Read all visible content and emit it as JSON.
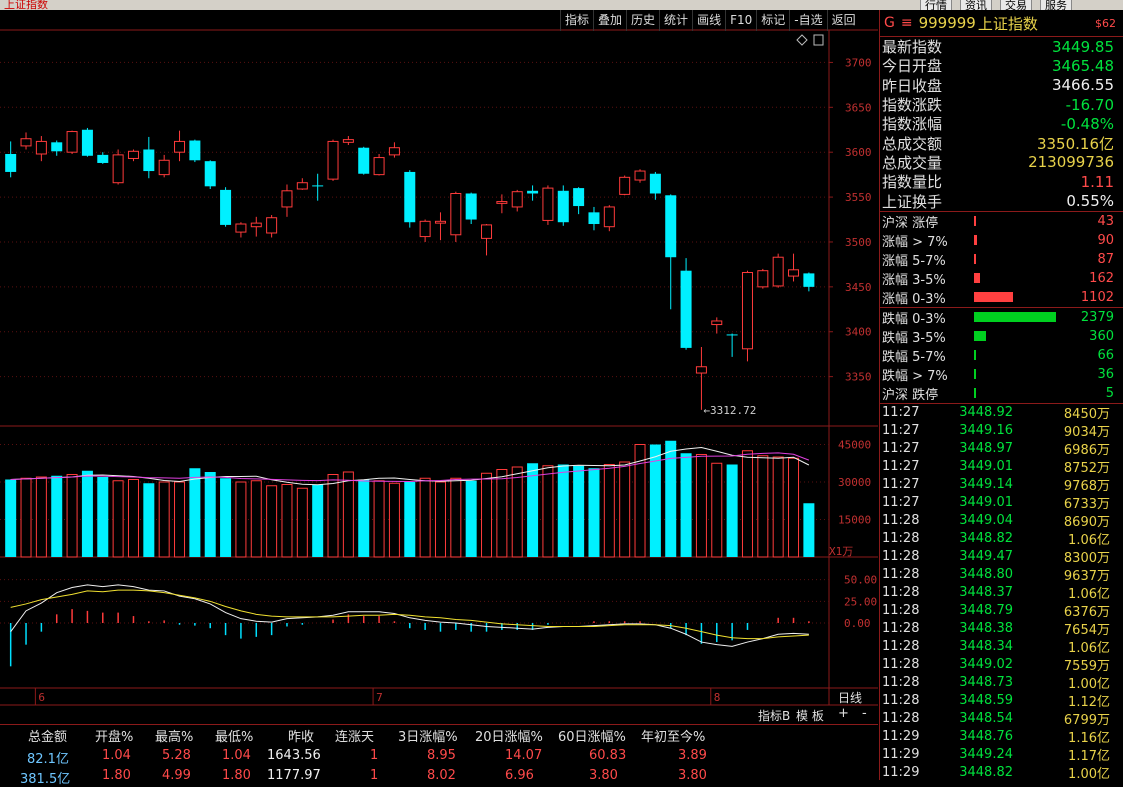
{
  "window": {
    "title_fragment": "上证指数"
  },
  "toolbar": {
    "items": [
      "指标",
      "叠加",
      "历史",
      "统计",
      "画线",
      "F10",
      "标记",
      "-自选",
      "返回"
    ]
  },
  "quote": {
    "code": "999999",
    "name": "上证指数",
    "g_label": "G",
    "menu_glyph": "≡",
    "badge": "$62",
    "fields": [
      {
        "label": "最新指数",
        "value": "3449.85",
        "color": "green"
      },
      {
        "label": "今日开盘",
        "value": "3465.48",
        "color": "green"
      },
      {
        "label": "昨日收盘",
        "value": "3466.55",
        "color": "white"
      },
      {
        "label": "指数涨跌",
        "value": "-16.70",
        "color": "green"
      },
      {
        "label": "指数涨幅",
        "value": "-0.48%",
        "color": "green"
      },
      {
        "label": "总成交额",
        "value": "3350.16亿",
        "color": "yellow"
      },
      {
        "label": "总成交量",
        "value": "213099736",
        "color": "yellow"
      },
      {
        "label": "指数量比",
        "value": "1.11",
        "color": "red"
      },
      {
        "label": "上证换手",
        "value": "0.55%",
        "color": "white"
      }
    ]
  },
  "breadth": {
    "up": [
      {
        "label": "沪深 涨停",
        "value": "43",
        "fraction": 0.0
      },
      {
        "label": "涨幅 > 7%",
        "value": "90",
        "fraction": 0.04
      },
      {
        "label": "涨幅 5-7%",
        "value": "87",
        "fraction": 0.03
      },
      {
        "label": "涨幅 3-5%",
        "value": "162",
        "fraction": 0.07
      },
      {
        "label": "涨幅 0-3%",
        "value": "1102",
        "fraction": 0.47
      }
    ],
    "down": [
      {
        "label": "跌幅 0-3%",
        "value": "2379",
        "fraction": 1.0
      },
      {
        "label": "跌幅 3-5%",
        "value": "360",
        "fraction": 0.15
      },
      {
        "label": "跌幅 5-7%",
        "value": "66",
        "fraction": 0.03
      },
      {
        "label": "跌幅 > 7%",
        "value": "36",
        "fraction": 0.01
      },
      {
        "label": "沪深 跌停",
        "value": "5",
        "fraction": 0.0
      }
    ]
  },
  "ticks": [
    {
      "time": "11:27",
      "price": "3448.92",
      "vol": "8450万"
    },
    {
      "time": "11:27",
      "price": "3449.16",
      "vol": "9034万"
    },
    {
      "time": "11:27",
      "price": "3448.97",
      "vol": "6986万"
    },
    {
      "time": "11:27",
      "price": "3449.01",
      "vol": "8752万"
    },
    {
      "time": "11:27",
      "price": "3449.14",
      "vol": "9768万"
    },
    {
      "time": "11:27",
      "price": "3449.01",
      "vol": "6733万"
    },
    {
      "time": "11:28",
      "price": "3449.04",
      "vol": "8690万"
    },
    {
      "time": "11:28",
      "price": "3448.82",
      "vol": "1.06亿"
    },
    {
      "time": "11:28",
      "price": "3449.47",
      "vol": "8300万"
    },
    {
      "time": "11:28",
      "price": "3448.80",
      "vol": "9637万"
    },
    {
      "time": "11:28",
      "price": "3448.37",
      "vol": "1.06亿"
    },
    {
      "time": "11:28",
      "price": "3448.79",
      "vol": "6376万"
    },
    {
      "time": "11:28",
      "price": "3448.38",
      "vol": "7654万"
    },
    {
      "time": "11:28",
      "price": "3448.34",
      "vol": "1.06亿"
    },
    {
      "time": "11:28",
      "price": "3449.02",
      "vol": "7559万"
    },
    {
      "time": "11:28",
      "price": "3448.73",
      "vol": "1.00亿"
    },
    {
      "time": "11:28",
      "price": "3448.59",
      "vol": "1.12亿"
    },
    {
      "time": "11:28",
      "price": "3448.54",
      "vol": "6799万"
    },
    {
      "time": "11:29",
      "price": "3448.76",
      "vol": "1.16亿"
    },
    {
      "time": "11:29",
      "price": "3449.24",
      "vol": "1.17亿"
    },
    {
      "time": "11:29",
      "price": "3448.82",
      "vol": "1.00亿"
    }
  ],
  "chart_data": [
    {
      "type": "candlestick",
      "y_ticks": [
        "3700",
        "3650",
        "3600",
        "3550",
        "3500",
        "3450",
        "3400",
        "3350"
      ],
      "ylim": [
        3295,
        3735
      ],
      "low_annotation": "←3312.72",
      "colors": {
        "up": "#ff3b3b",
        "down": "#00f0ff"
      },
      "candles": [
        {
          "o": 3598,
          "c": 3578,
          "h": 3612,
          "l": 3572
        },
        {
          "o": 3607,
          "c": 3615,
          "h": 3622,
          "l": 3603
        },
        {
          "o": 3598,
          "c": 3612,
          "h": 3618,
          "l": 3590
        },
        {
          "o": 3611,
          "c": 3601,
          "h": 3613,
          "l": 3596
        },
        {
          "o": 3600,
          "c": 3623,
          "h": 3624,
          "l": 3598
        },
        {
          "o": 3625,
          "c": 3596,
          "h": 3627,
          "l": 3595
        },
        {
          "o": 3597,
          "c": 3588,
          "h": 3600,
          "l": 3587
        },
        {
          "o": 3566,
          "c": 3597,
          "h": 3603,
          "l": 3564
        },
        {
          "o": 3593,
          "c": 3601,
          "h": 3603,
          "l": 3590
        },
        {
          "o": 3603,
          "c": 3579,
          "h": 3617,
          "l": 3571
        },
        {
          "o": 3575,
          "c": 3591,
          "h": 3597,
          "l": 3572
        },
        {
          "o": 3600,
          "c": 3612,
          "h": 3624,
          "l": 3590
        },
        {
          "o": 3613,
          "c": 3591,
          "h": 3614,
          "l": 3589
        },
        {
          "o": 3590,
          "c": 3562,
          "h": 3591,
          "l": 3559
        },
        {
          "o": 3558,
          "c": 3519,
          "h": 3561,
          "l": 3517
        },
        {
          "o": 3511,
          "c": 3520,
          "h": 3522,
          "l": 3505
        },
        {
          "o": 3517,
          "c": 3521,
          "h": 3528,
          "l": 3506
        },
        {
          "o": 3510,
          "c": 3527,
          "h": 3530,
          "l": 3505
        },
        {
          "o": 3539,
          "c": 3557,
          "h": 3564,
          "l": 3528
        },
        {
          "o": 3559,
          "c": 3566,
          "h": 3571,
          "l": 3558
        },
        {
          "o": 3563,
          "c": 3562,
          "h": 3576,
          "l": 3546
        },
        {
          "o": 3570,
          "c": 3612,
          "h": 3614,
          "l": 3568
        },
        {
          "o": 3611,
          "c": 3614,
          "h": 3618,
          "l": 3608
        },
        {
          "o": 3605,
          "c": 3576,
          "h": 3606,
          "l": 3575
        },
        {
          "o": 3575,
          "c": 3594,
          "h": 3598,
          "l": 3574
        },
        {
          "o": 3597,
          "c": 3605,
          "h": 3611,
          "l": 3594
        },
        {
          "o": 3578,
          "c": 3522,
          "h": 3580,
          "l": 3516
        },
        {
          "o": 3506,
          "c": 3523,
          "h": 3525,
          "l": 3500
        },
        {
          "o": 3521,
          "c": 3523,
          "h": 3533,
          "l": 3502
        },
        {
          "o": 3508,
          "c": 3554,
          "h": 3556,
          "l": 3500
        },
        {
          "o": 3554,
          "c": 3525,
          "h": 3555,
          "l": 3520
        },
        {
          "o": 3504,
          "c": 3519,
          "h": 3520,
          "l": 3485
        },
        {
          "o": 3543,
          "c": 3545,
          "h": 3553,
          "l": 3532
        },
        {
          "o": 3539,
          "c": 3556,
          "h": 3558,
          "l": 3534
        },
        {
          "o": 3557,
          "c": 3554,
          "h": 3563,
          "l": 3546
        },
        {
          "o": 3524,
          "c": 3560,
          "h": 3563,
          "l": 3519
        },
        {
          "o": 3557,
          "c": 3522,
          "h": 3563,
          "l": 3518
        },
        {
          "o": 3560,
          "c": 3540,
          "h": 3561,
          "l": 3531
        },
        {
          "o": 3533,
          "c": 3520,
          "h": 3539,
          "l": 3513
        },
        {
          "o": 3517,
          "c": 3539,
          "h": 3541,
          "l": 3512
        },
        {
          "o": 3553,
          "c": 3572,
          "h": 3574,
          "l": 3552
        },
        {
          "o": 3569,
          "c": 3579,
          "h": 3581,
          "l": 3566
        },
        {
          "o": 3576,
          "c": 3554,
          "h": 3578,
          "l": 3547
        },
        {
          "o": 3552,
          "c": 3483,
          "h": 3553,
          "l": 3425
        },
        {
          "o": 3468,
          "c": 3382,
          "h": 3482,
          "l": 3380
        },
        {
          "o": 3354,
          "c": 3361,
          "h": 3383,
          "l": 3313
        },
        {
          "o": 3408,
          "c": 3412,
          "h": 3416,
          "l": 3398
        },
        {
          "o": 3397,
          "c": 3396,
          "h": 3398,
          "l": 3372
        },
        {
          "o": 3381,
          "c": 3466,
          "h": 3468,
          "l": 3367
        },
        {
          "o": 3450,
          "c": 3468,
          "h": 3470,
          "l": 3448
        },
        {
          "o": 3451,
          "c": 3483,
          "h": 3487,
          "l": 3449
        },
        {
          "o": 3462,
          "c": 3469,
          "h": 3487,
          "l": 3456
        },
        {
          "o": 3465,
          "c": 3450,
          "h": 3466,
          "l": 3445
        }
      ]
    },
    {
      "type": "bar",
      "title": "volume",
      "y_ticks": [
        "45000",
        "30000",
        "15000"
      ],
      "unit_label": "X1万",
      "ylim": [
        0,
        52000
      ],
      "values": [
        31000,
        31500,
        32000,
        32500,
        33000,
        34500,
        32000,
        30500,
        31000,
        29500,
        30000,
        30000,
        35500,
        34000,
        31500,
        30000,
        30500,
        28500,
        29000,
        27500,
        29000,
        33000,
        34000,
        31000,
        30500,
        29500,
        30000,
        31500,
        30000,
        31500,
        30500,
        33500,
        35000,
        36000,
        37500,
        36500,
        37000,
        36500,
        35500,
        37000,
        38000,
        45000,
        45000,
        46500,
        41500,
        41000,
        37500,
        37000,
        42500,
        40500,
        40000,
        39500,
        21500
      ]
    },
    {
      "type": "line",
      "title": "MACD",
      "y_ticks": [
        "50.00",
        "25.00",
        "0.00"
      ],
      "ylim": [
        -75,
        75
      ]
    }
  ],
  "macd": {
    "dif": [
      -10,
      14,
      23,
      35,
      41,
      44,
      42,
      44,
      42,
      38,
      37,
      31,
      28,
      22,
      12,
      5,
      2,
      1,
      5,
      6,
      7,
      9,
      13,
      13,
      13,
      11,
      6,
      3,
      1,
      0,
      -2,
      -4,
      -5,
      -6,
      -7,
      -5,
      -4,
      -4,
      -3,
      -2,
      -1,
      -1,
      -2,
      -6,
      -13,
      -22,
      -25,
      -27,
      -22,
      -18,
      -13,
      -12,
      -13
    ],
    "dea": [
      18,
      22,
      27,
      30,
      33,
      37,
      36,
      38,
      38,
      37,
      35,
      32,
      29,
      25,
      19,
      14,
      10,
      8,
      7,
      7,
      7,
      7,
      8,
      9,
      9,
      10,
      9,
      7,
      6,
      4,
      3,
      1,
      -1,
      -2,
      -3,
      -4,
      -4,
      -4,
      -4,
      -3,
      -2,
      -2,
      -2,
      -3,
      -6,
      -10,
      -14,
      -17,
      -18,
      -18,
      -16,
      -15,
      -14
    ],
    "hist": [
      -50,
      -25,
      -10,
      10,
      16,
      14,
      12,
      12,
      8,
      2,
      3,
      -2,
      -3,
      -6,
      -14,
      -18,
      -16,
      -14,
      -4,
      -2,
      0,
      4,
      10,
      8,
      8,
      2,
      -6,
      -8,
      -10,
      -8,
      -10,
      -10,
      -8,
      -8,
      -8,
      -2,
      0,
      0,
      2,
      2,
      2,
      2,
      0,
      -6,
      -14,
      -24,
      -22,
      -20,
      -8,
      0,
      6,
      6,
      2
    ]
  },
  "x_axis": {
    "labels": [
      {
        "text": "6",
        "index": 2
      },
      {
        "text": "7",
        "index": 24
      },
      {
        "text": "8",
        "index": 46
      }
    ],
    "right_label": "日线"
  },
  "tabs": {
    "items": [
      "指标B",
      "模 板"
    ],
    "plus": "+",
    "minus": "-"
  },
  "table": {
    "headers": [
      "总金额",
      "开盘%",
      "最高%",
      "最低%",
      "昨收",
      "连涨天",
      "3日涨幅%",
      "20日涨幅%",
      "60日涨幅%",
      "年初至今%"
    ],
    "rows": [
      [
        "82.1亿",
        "1.04",
        "5.28",
        "1.04",
        "1643.56",
        "1",
        "8.95",
        "14.07",
        "60.83",
        "3.89"
      ],
      [
        "381.5亿",
        "1.80",
        "4.99",
        "1.80",
        "1177.97",
        "1",
        "8.02",
        "6.96",
        "3.80",
        "3.80"
      ]
    ]
  }
}
